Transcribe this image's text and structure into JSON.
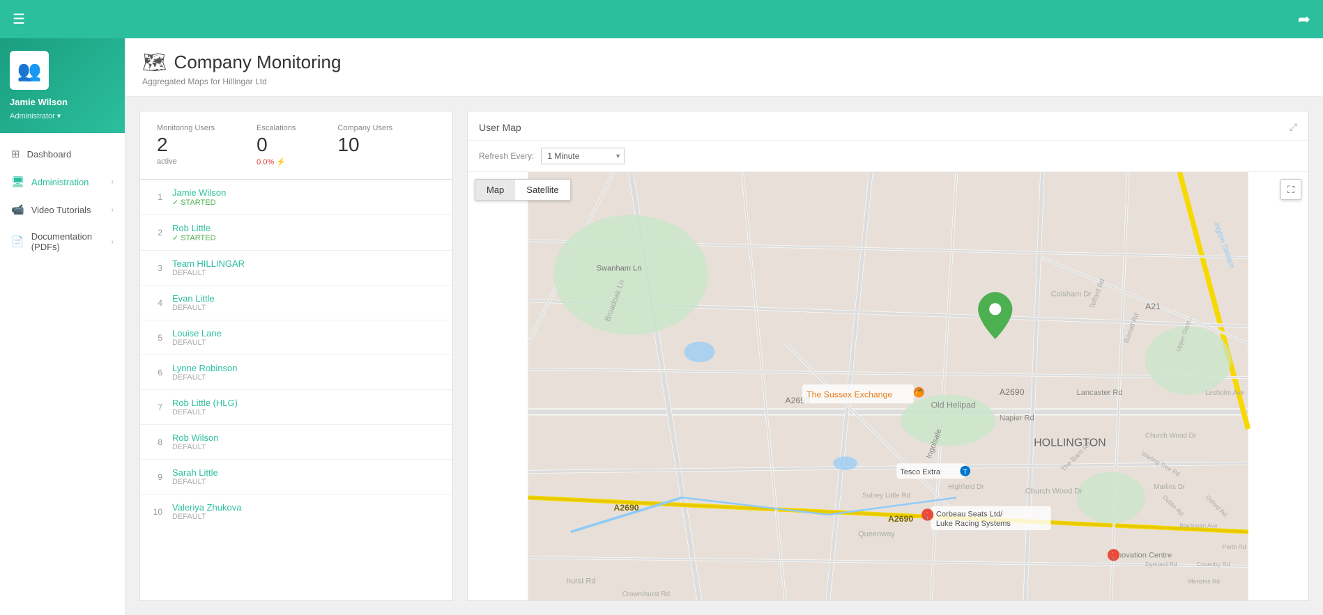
{
  "topbar": {
    "hamburger": "☰",
    "logout_icon": "➦"
  },
  "sidebar": {
    "user": {
      "name": "Jamie Wilson",
      "role": "Administrator",
      "avatar_emoji": "👥"
    },
    "nav_items": [
      {
        "id": "dashboard",
        "label": "Dashboard",
        "icon": "⊞",
        "has_chevron": false,
        "active": false
      },
      {
        "id": "administration",
        "label": "Administration",
        "icon": "🖥",
        "has_chevron": true,
        "active": true
      },
      {
        "id": "video-tutorials",
        "label": "Video Tutorials",
        "icon": "📹",
        "has_chevron": true,
        "active": false
      },
      {
        "id": "documentation",
        "label": "Documentation (PDFs)",
        "icon": "📄",
        "has_chevron": true,
        "active": false
      }
    ]
  },
  "page": {
    "title": "Company Monitoring",
    "subtitle": "Aggregated Maps for Hillingar Ltd",
    "title_icon": "🗺"
  },
  "stats": {
    "monitoring_users_label": "Monitoring Users",
    "monitoring_users_value": "2",
    "monitoring_users_sub": "active",
    "escalations_label": "Escalations",
    "escalations_value": "0",
    "escalations_sub": "0.0%",
    "company_users_label": "Company Users",
    "company_users_value": "10"
  },
  "users": [
    {
      "num": "1",
      "name": "Jamie Wilson",
      "status": "STARTED",
      "status_type": "started"
    },
    {
      "num": "2",
      "name": "Rob Little",
      "status": "STARTED",
      "status_type": "started"
    },
    {
      "num": "3",
      "name": "Team HILLINGAR",
      "status": "DEFAULT",
      "status_type": "default"
    },
    {
      "num": "4",
      "name": "Evan Little",
      "status": "DEFAULT",
      "status_type": "default"
    },
    {
      "num": "5",
      "name": "Louise Lane",
      "status": "DEFAULT",
      "status_type": "default"
    },
    {
      "num": "6",
      "name": "Lynne Robinson",
      "status": "DEFAULT",
      "status_type": "default"
    },
    {
      "num": "7",
      "name": "Rob Little (HLG)",
      "status": "DEFAULT",
      "status_type": "default"
    },
    {
      "num": "8",
      "name": "Rob Wilson",
      "status": "DEFAULT",
      "status_type": "default"
    },
    {
      "num": "9",
      "name": "Sarah Little",
      "status": "DEFAULT",
      "status_type": "default"
    },
    {
      "num": "10",
      "name": "Valeriya Zhukova",
      "status": "DEFAULT",
      "status_type": "default"
    }
  ],
  "map": {
    "title": "User Map",
    "refresh_label": "Refresh Every:",
    "refresh_option": "1 Minute",
    "map_btn_map": "Map",
    "map_btn_satellite": "Satellite"
  }
}
